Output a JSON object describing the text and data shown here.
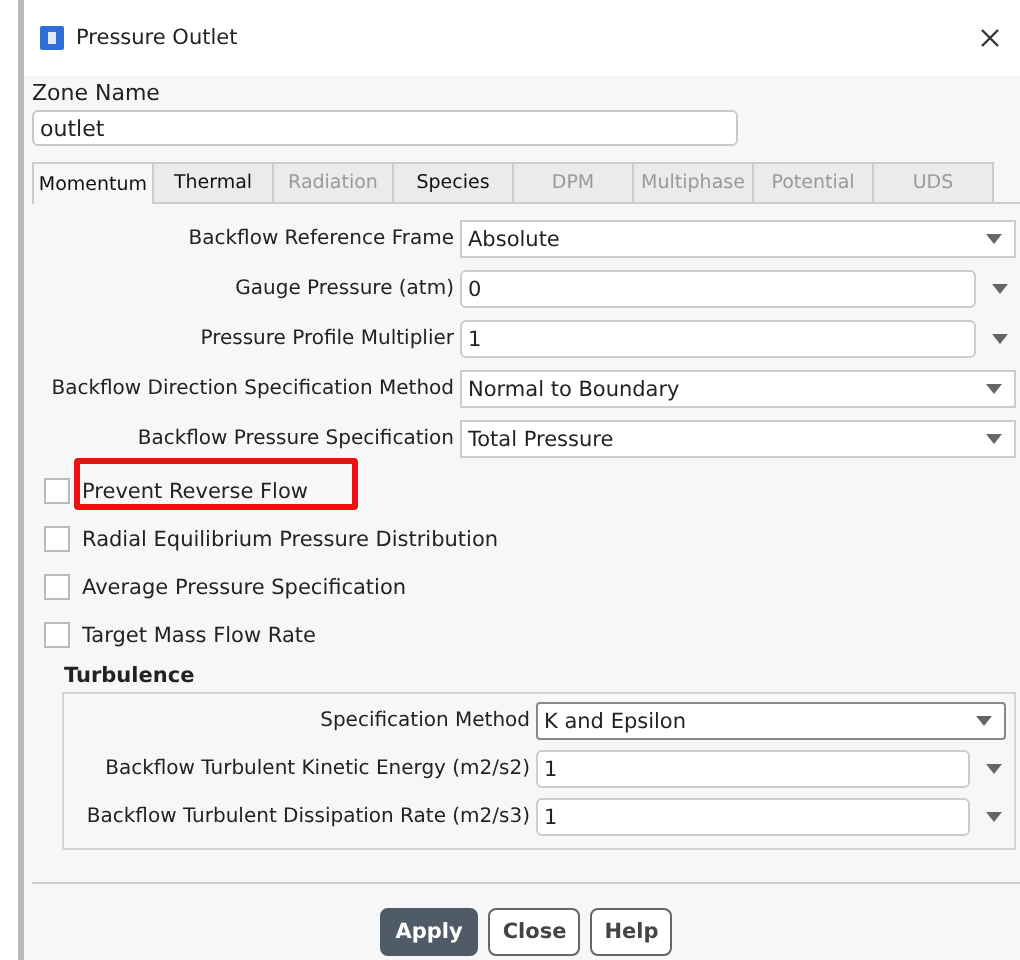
{
  "window": {
    "title": "Pressure Outlet"
  },
  "zone_name": {
    "label": "Zone Name",
    "value": "outlet"
  },
  "tabs": [
    {
      "label": "Momentum",
      "selected": true,
      "disabled": false
    },
    {
      "label": "Thermal",
      "selected": false,
      "disabled": false
    },
    {
      "label": "Radiation",
      "selected": false,
      "disabled": true
    },
    {
      "label": "Species",
      "selected": false,
      "disabled": false
    },
    {
      "label": "DPM",
      "selected": false,
      "disabled": true
    },
    {
      "label": "Multiphase",
      "selected": false,
      "disabled": true
    },
    {
      "label": "Potential",
      "selected": false,
      "disabled": true
    },
    {
      "label": "UDS",
      "selected": false,
      "disabled": true
    }
  ],
  "fields": [
    {
      "kind": "dropdown",
      "label": "Backflow Reference Frame",
      "value": "Absolute"
    },
    {
      "kind": "number",
      "label": "Gauge Pressure (atm)",
      "value": "0"
    },
    {
      "kind": "number",
      "label": "Pressure Profile Multiplier",
      "value": "1"
    },
    {
      "kind": "dropdown",
      "label": "Backflow Direction Specification Method",
      "value": "Normal to Boundary"
    },
    {
      "kind": "dropdown",
      "label": "Backflow Pressure Specification",
      "value": "Total Pressure"
    }
  ],
  "options": [
    {
      "label": "Prevent Reverse Flow",
      "checked": false,
      "highlighted": true
    },
    {
      "label": "Radial Equilibrium Pressure Distribution",
      "checked": false,
      "highlighted": false
    },
    {
      "label": "Average Pressure Specification",
      "checked": false,
      "highlighted": false
    },
    {
      "label": "Target Mass Flow Rate",
      "checked": false,
      "highlighted": false
    }
  ],
  "turbulence": {
    "title": "Turbulence",
    "fields": [
      {
        "kind": "dropdown",
        "label": "Specification Method",
        "value": "K and Epsilon"
      },
      {
        "kind": "number",
        "label": "Backflow Turbulent Kinetic Energy (m2/s2)",
        "value": "1"
      },
      {
        "kind": "number",
        "label": "Backflow Turbulent Dissipation Rate (m2/s3)",
        "value": "1"
      }
    ]
  },
  "buttons": [
    {
      "label": "Apply",
      "kind": "primary"
    },
    {
      "label": "Close",
      "kind": "normal"
    },
    {
      "label": "Help",
      "kind": "normal"
    }
  ]
}
